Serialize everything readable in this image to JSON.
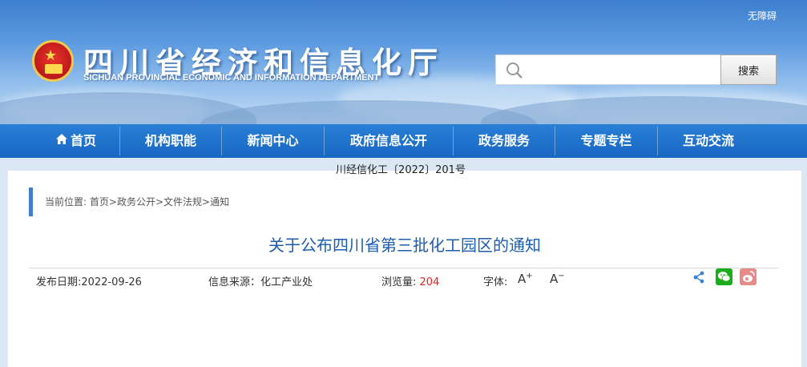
{
  "header": {
    "accessibility_link": "无障碍",
    "site_title": "四川省经济和信息化厅",
    "site_subtitle": "SICHUAN PROVINCIAL ECONOMIC AND INFORMATION DEPARTMENT",
    "search": {
      "value": "",
      "placeholder": "",
      "button_label": "搜索"
    }
  },
  "nav": {
    "items": [
      {
        "label": "首页",
        "icon": "home-icon"
      },
      {
        "label": "机构职能"
      },
      {
        "label": "新闻中心"
      },
      {
        "label": "政府信息公开"
      },
      {
        "label": "政务服务"
      },
      {
        "label": "专题专栏"
      },
      {
        "label": "互动交流"
      }
    ]
  },
  "breadcrumb": {
    "prefix": "当前位置:",
    "items": [
      "首页",
      "政务公开",
      "文件法规",
      "通知"
    ],
    "separator": ">"
  },
  "article": {
    "title": "关于公布四川省第三批化工园区的通知",
    "publish_date_label": "发布日期:",
    "publish_date": "2022-09-26",
    "source_label": "信息来源：",
    "source": "化工产业处",
    "views_label": "浏览量:",
    "views": "204",
    "font_label": "字体:",
    "font_increase": "A",
    "font_decrease": "A",
    "doc_number": "川经信化工〔2022〕201号"
  },
  "share": {
    "icons": [
      "share-icon",
      "wechat-icon",
      "weibo-icon"
    ]
  },
  "colors": {
    "nav_bg": "#1767c2",
    "title_blue": "#1d5dac",
    "views_red": "#e02020",
    "wechat_green": "#1aad19",
    "weibo_pink": "#e88a8a"
  }
}
